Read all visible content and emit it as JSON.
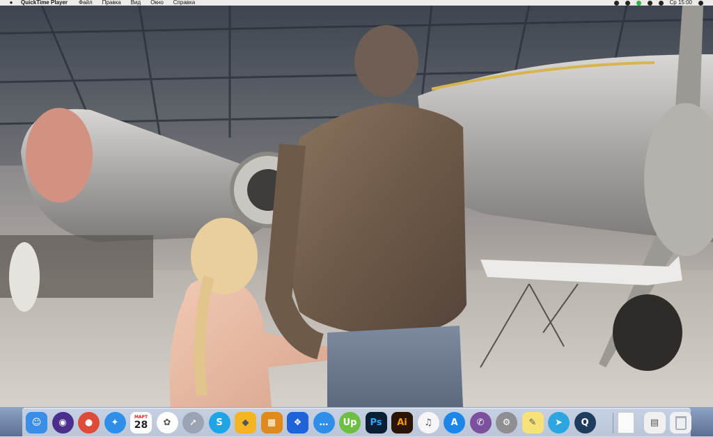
{
  "menubar": {
    "apple": "",
    "app_name": "QuickTime Player",
    "items": [
      "Файл",
      "Правка",
      "Вид",
      "Окно",
      "Справка"
    ],
    "clock": "Ср 15:00"
  },
  "dock": {
    "calendar": {
      "month": "МАРТ",
      "day": "28"
    },
    "items": [
      {
        "name": "Finder",
        "icon": "finder-icon",
        "glyph": "☺",
        "color": "#3a8ee8"
      },
      {
        "name": "Siri",
        "icon": "siri-icon",
        "glyph": "◉",
        "color": "#4a2f8c"
      },
      {
        "name": "Chrome",
        "icon": "chrome-icon",
        "glyph": "●",
        "color": "#dd4b39"
      },
      {
        "name": "Safari",
        "icon": "safari-icon",
        "glyph": "✦",
        "color": "#2f8fe8"
      },
      {
        "name": "Calendar",
        "icon": "calendar-icon",
        "glyph": "",
        "color": "#ffffff"
      },
      {
        "name": "Photos",
        "icon": "photos-icon",
        "glyph": "✿",
        "color": "#ffffff"
      },
      {
        "name": "Launchpad",
        "icon": "rocket-icon",
        "glyph": "➚",
        "color": "#9aa4b2"
      },
      {
        "name": "Skype",
        "icon": "skype-icon",
        "glyph": "S",
        "color": "#1fa5e6"
      },
      {
        "name": "Sketch",
        "icon": "sketch-icon",
        "glyph": "◆",
        "color": "#f3b622"
      },
      {
        "name": "Calculator",
        "icon": "calculator-icon",
        "glyph": "▦",
        "color": "#e08a1e"
      },
      {
        "name": "Dropbox",
        "icon": "dropbox-icon",
        "glyph": "❖",
        "color": "#1e63d8"
      },
      {
        "name": "Messages",
        "icon": "messages-icon",
        "glyph": "…",
        "color": "#2f8fe8"
      },
      {
        "name": "Upwork",
        "icon": "upwork-icon",
        "glyph": "Up",
        "color": "#6fbe44"
      },
      {
        "name": "Photoshop",
        "icon": "photoshop-icon",
        "glyph": "Ps",
        "color": "#0a1f33"
      },
      {
        "name": "Illustrator",
        "icon": "illustrator-icon",
        "glyph": "Ai",
        "color": "#2b1404"
      },
      {
        "name": "iTunes",
        "icon": "itunes-icon",
        "glyph": "♫",
        "color": "#f6f6f8"
      },
      {
        "name": "App Store",
        "icon": "app-store-icon",
        "glyph": "A",
        "color": "#1e86e8"
      },
      {
        "name": "Viber",
        "icon": "viber-icon",
        "glyph": "✆",
        "color": "#7b519d"
      },
      {
        "name": "System Preferences",
        "icon": "gear-icon",
        "glyph": "⚙",
        "color": "#8e8e93"
      },
      {
        "name": "Notes",
        "icon": "notes-icon",
        "glyph": "✎",
        "color": "#f7e27a"
      },
      {
        "name": "Telegram",
        "icon": "telegram-icon",
        "glyph": "➤",
        "color": "#2ca5e0"
      },
      {
        "name": "QuickTime Player",
        "icon": "quicktime-icon",
        "glyph": "Q",
        "color": "#1d3c5e"
      },
      {
        "name": "Document",
        "icon": "document-icon",
        "glyph": "",
        "color": "#fafafa"
      },
      {
        "name": "Preview",
        "icon": "preview-icon",
        "glyph": "▤",
        "color": "#f0f0f0"
      },
      {
        "name": "Trash",
        "icon": "trash-icon",
        "glyph": "",
        "color": "#eef0f3"
      }
    ]
  }
}
